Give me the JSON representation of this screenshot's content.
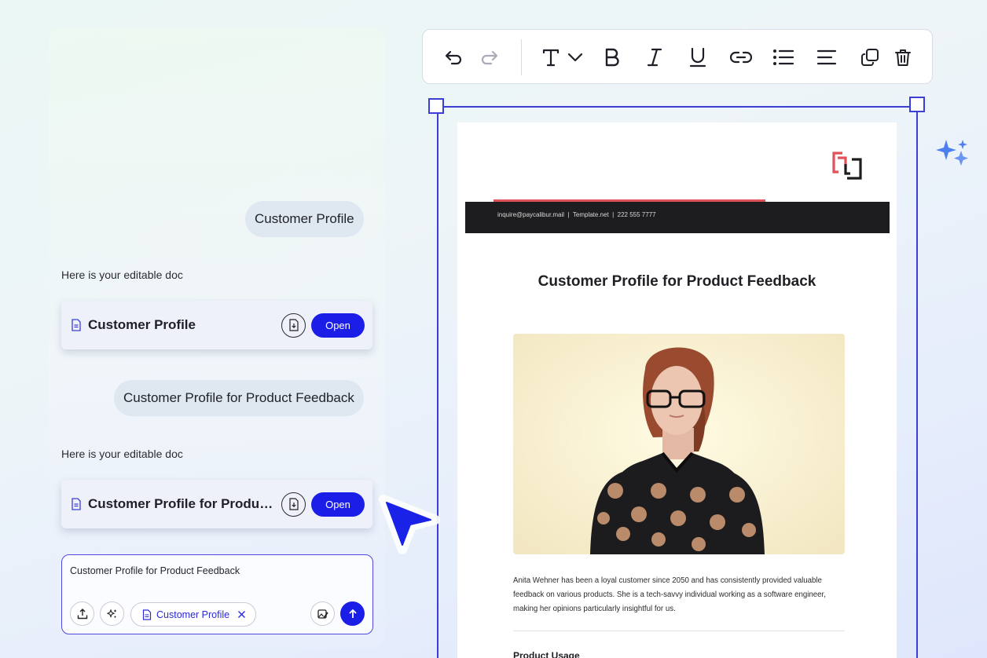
{
  "chat": {
    "messages": [
      {
        "role": "user",
        "text": "Customer Profile"
      },
      {
        "role": "assistant",
        "text": "Here is your editable doc",
        "card": {
          "title": "Customer Profile",
          "open_label": "Open"
        }
      },
      {
        "role": "user",
        "text": "Customer Profile for Product Feedback"
      },
      {
        "role": "assistant",
        "text": "Here is your editable doc",
        "card": {
          "title": "Customer Profile for Product Feedback",
          "open_label": "Open"
        }
      }
    ],
    "composer": {
      "value": "Customer Profile for Product Feedback",
      "attachment_chip": "Customer Profile"
    }
  },
  "toolbar": {
    "items": [
      "undo-icon",
      "redo-icon",
      "text-style-icon",
      "chevron-down-icon",
      "bold-icon",
      "italic-icon",
      "underline-icon",
      "link-icon",
      "bullet-list-icon",
      "align-left-icon",
      "duplicate-icon",
      "delete-icon"
    ]
  },
  "document": {
    "contact_line": "inquire@paycalibur.mail  |  Template.net  |  222 555 7777",
    "title": "Customer Profile for Product Feedback",
    "paragraph": "Anita Wehner has been a loyal customer since 2050 and has consistently provided valuable feedback on various products. She is a tech-savvy individual working as a software engineer, making her opinions particularly insightful for us.",
    "section_heading": "Product Usage"
  },
  "colors": {
    "accent": "#1a1ee6",
    "selection": "#3b3fd6",
    "logo_red": "#e0525a",
    "band": "#1d1d1f"
  }
}
